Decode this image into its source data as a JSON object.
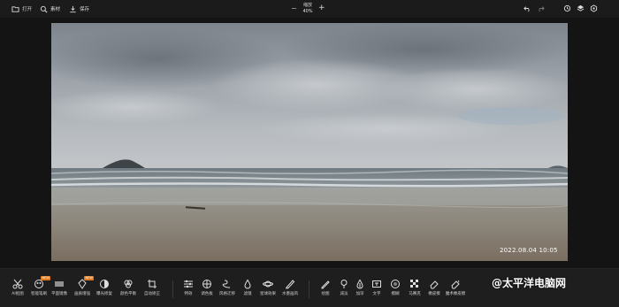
{
  "topbar": {
    "open_label": "打开",
    "material_label": "素材",
    "save_label": "保存",
    "zoom_title": "缩放",
    "zoom_value": "40%",
    "zoom_minus": "−",
    "zoom_plus": "+",
    "right_icons": [
      "undo-icon",
      "redo-icon",
      "history-icon",
      "layers-icon",
      "settings-icon"
    ]
  },
  "photo": {
    "timestamp": "2022.08.04  10:05"
  },
  "tools": [
    {
      "label": "AI抠图",
      "icon": "scissors-icon"
    },
    {
      "label": "智能笔刷",
      "icon": "smart-brush-icon",
      "badge": "NEW"
    },
    {
      "label": "平面镜像",
      "icon": "mirror-icon"
    },
    {
      "label": "画质增强",
      "icon": "enhance-icon",
      "badge": "NEW"
    },
    {
      "label": "曝光修复",
      "icon": "exposure-icon"
    },
    {
      "label": "颜色平衡",
      "icon": "color-balance-icon"
    },
    {
      "label": "自动矫正",
      "icon": "crop-icon"
    },
    {
      "label": "特效",
      "icon": "sliders-icon"
    },
    {
      "label": "调色板",
      "icon": "palette-icon"
    },
    {
      "label": "风格迁移",
      "icon": "style-icon"
    },
    {
      "label": "滤镜",
      "icon": "drop-icon"
    },
    {
      "label": "星球效果",
      "icon": "planet-icon"
    },
    {
      "label": "水墨画风",
      "icon": "ink-icon"
    },
    {
      "label": "绘图",
      "icon": "pencil-icon"
    },
    {
      "label": "减淡",
      "icon": "dodge-icon"
    },
    {
      "label": "加深",
      "icon": "burn-icon"
    },
    {
      "label": "文字",
      "icon": "text-icon"
    },
    {
      "label": "模糊",
      "icon": "blur-icon"
    },
    {
      "label": "马赛克",
      "icon": "mosaic-icon"
    },
    {
      "label": "橡皮擦",
      "icon": "eraser-icon"
    },
    {
      "label": "魔术橡皮擦",
      "icon": "magic-eraser-icon"
    }
  ],
  "watermark": {
    "at": "@",
    "text": "太平洋电脑网"
  },
  "colors": {
    "background": "#141414",
    "bar": "#1e1e1e",
    "badge": "#e07a1f"
  }
}
